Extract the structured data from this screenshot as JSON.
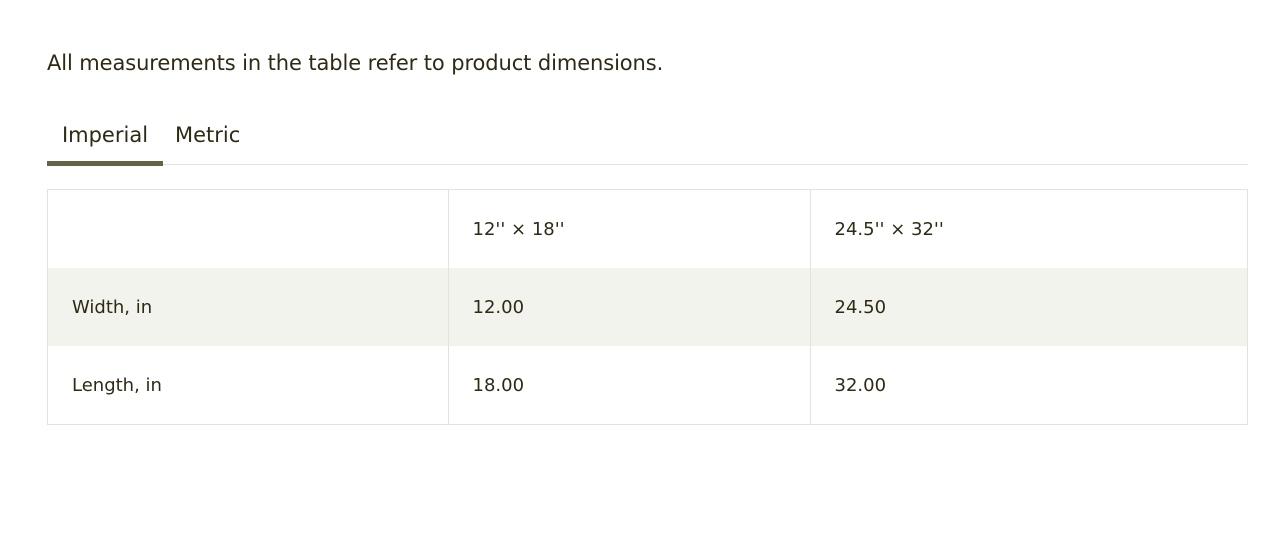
{
  "intro_text": "All measurements in the table refer to product dimensions.",
  "tabs": [
    {
      "label": "Imperial",
      "active": true
    },
    {
      "label": "Metric",
      "active": false
    }
  ],
  "table": {
    "headers": [
      "",
      "12'' × 18''",
      "24.5'' × 32''"
    ],
    "rows": [
      {
        "label": "Width, in",
        "values": [
          "12.00",
          "24.50"
        ]
      },
      {
        "label": "Length, in",
        "values": [
          "18.00",
          "32.00"
        ]
      }
    ]
  },
  "colors": {
    "text": "#2e2a14",
    "tab_indicator": "#63634a",
    "row_shade": "#f3f3ee",
    "border": "#e3e3dc"
  }
}
